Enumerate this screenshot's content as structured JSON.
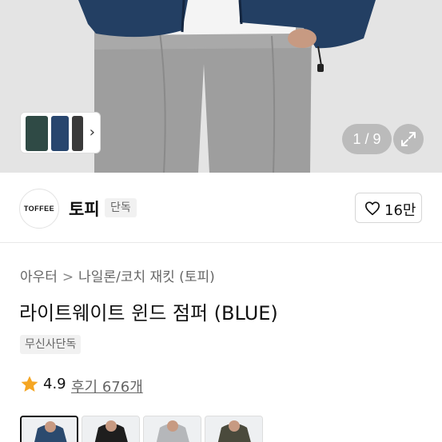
{
  "gallery": {
    "counter": "1 / 9",
    "thumb_arrow": "›"
  },
  "brand": {
    "logo_text": "TOFFEE",
    "name": "토피",
    "badge": "단독",
    "like_count": "16만"
  },
  "breadcrumb": [
    "아우터",
    "나일론/코치 재킷 (토피)"
  ],
  "product": {
    "title": "라이트웨이트 윈드 점퍼 (BLUE)",
    "exclusive_badge": "무신사단독"
  },
  "rating": {
    "score": "4.9",
    "reviews": "후기 676개",
    "star_color": "#f5a623"
  },
  "swatches": [
    {
      "name": "blue",
      "color": "#2b4a6e",
      "selected": true
    },
    {
      "name": "black",
      "color": "#1e1e1e",
      "selected": false
    },
    {
      "name": "gray",
      "color": "#b5b7ba",
      "selected": false
    },
    {
      "name": "khaki",
      "color": "#4a4a3c",
      "selected": false
    }
  ]
}
